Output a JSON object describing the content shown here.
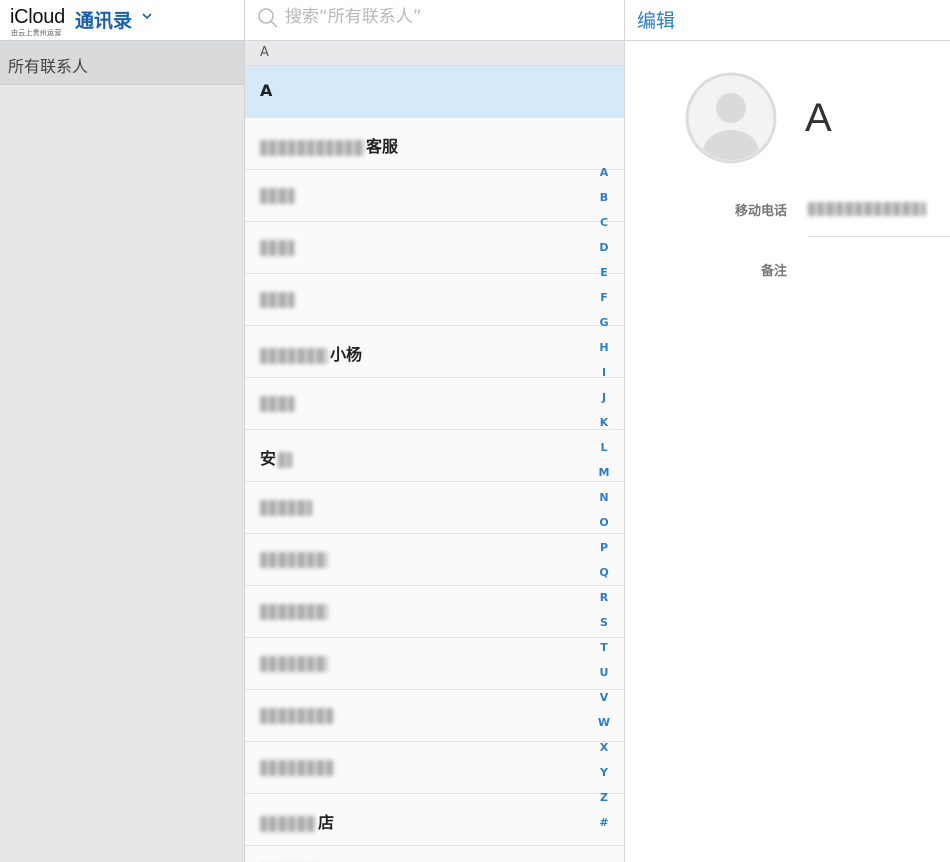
{
  "sidebar": {
    "brand": "iCloud",
    "app_title": "通讯录",
    "subtitle": "由云上贵州运营",
    "groups": [
      {
        "label": "所有联系人"
      }
    ]
  },
  "search": {
    "placeholder": "搜索“所有联系人”",
    "value": ""
  },
  "list": {
    "section_header": "A",
    "rows": [
      {
        "visible_text": "A",
        "selected": true
      },
      {
        "visible_text": "客服",
        "selected": false
      },
      {
        "visible_text": "",
        "selected": false
      },
      {
        "visible_text": "",
        "selected": false
      },
      {
        "visible_text": "",
        "selected": false
      },
      {
        "visible_text": "小杨",
        "selected": false
      },
      {
        "visible_text": "",
        "selected": false
      },
      {
        "visible_text": "安",
        "selected": false
      },
      {
        "visible_text": "",
        "selected": false
      },
      {
        "visible_text": "",
        "selected": false
      },
      {
        "visible_text": "",
        "selected": false
      },
      {
        "visible_text": "",
        "selected": false
      },
      {
        "visible_text": "",
        "selected": false
      },
      {
        "visible_text": "",
        "selected": false
      },
      {
        "visible_text": "店",
        "selected": false
      }
    ],
    "alpha_index": [
      "A",
      "B",
      "C",
      "D",
      "E",
      "F",
      "G",
      "H",
      "I",
      "J",
      "K",
      "L",
      "M",
      "N",
      "O",
      "P",
      "Q",
      "R",
      "S",
      "T",
      "U",
      "V",
      "W",
      "X",
      "Y",
      "Z",
      "#"
    ]
  },
  "detail": {
    "edit_label": "编辑",
    "contact_name": "A",
    "phone_label": "移动电话",
    "phone_value": "",
    "note_label": "备注"
  },
  "colors": {
    "accent": "#2c7ec9",
    "brand_blue": "#1a5fa8",
    "selected_row": "#d6e9f8",
    "sidebar_bg": "#e6e7e9"
  },
  "icons": {
    "search": "search-icon",
    "chevron": "chevron-down-icon",
    "avatar": "avatar-placeholder-icon"
  }
}
